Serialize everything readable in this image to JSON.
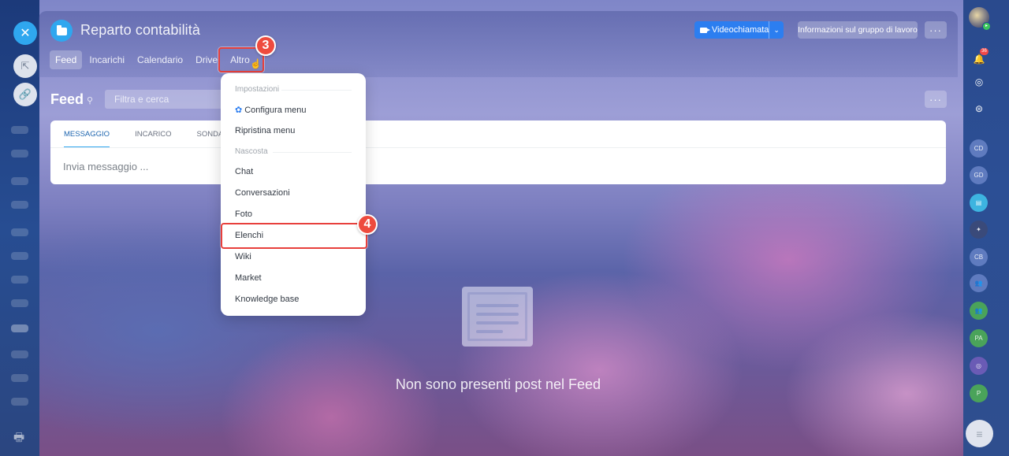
{
  "window": {
    "group_title": "Reparto contabilità",
    "video_button": "Videochiamata",
    "info_button": "Informazioni sul gruppo di lavoro",
    "more_glyph": "···"
  },
  "tabs": [
    {
      "label": "Feed",
      "active": true
    },
    {
      "label": "Incarichi",
      "active": false
    },
    {
      "label": "Calendario",
      "active": false
    },
    {
      "label": "Drive",
      "active": false
    },
    {
      "label": "Altro",
      "active": false
    }
  ],
  "feed": {
    "title": "Feed",
    "filter_placeholder": "Filtra e cerca",
    "composer_tabs": [
      "MESSAGGIO",
      "INCARICO",
      "SONDAGG"
    ],
    "composer_placeholder": "Invia messaggio ...",
    "empty_text": "Non sono presenti post nel Feed"
  },
  "dropdown": {
    "section_settings": "Impostazioni",
    "configure_menu": "Configura menu",
    "reset_menu": "Ripristina menu",
    "section_hidden": "Nascosta",
    "hidden_items": [
      "Chat",
      "Conversazioni",
      "Foto",
      "Elenchi",
      "Wiki",
      "Market",
      "Knowledge base"
    ]
  },
  "annotations": {
    "step_3": "3",
    "step_4": "4"
  },
  "right_rail": {
    "notification_count": "36",
    "avatars": [
      "CD",
      "GD",
      "CB",
      "PA",
      "P"
    ]
  },
  "icons": {
    "close": "close-icon",
    "folder": "folder-icon",
    "camera": "video-camera-icon",
    "gear": "gear-icon",
    "bell": "bell-icon",
    "print": "print-icon",
    "menu": "menu-icon"
  },
  "colors": {
    "accent": "#2fa7ef",
    "video_button": "#2c7ef0",
    "highlight": "#e8403c",
    "step_badge": "#ee4b3e"
  }
}
